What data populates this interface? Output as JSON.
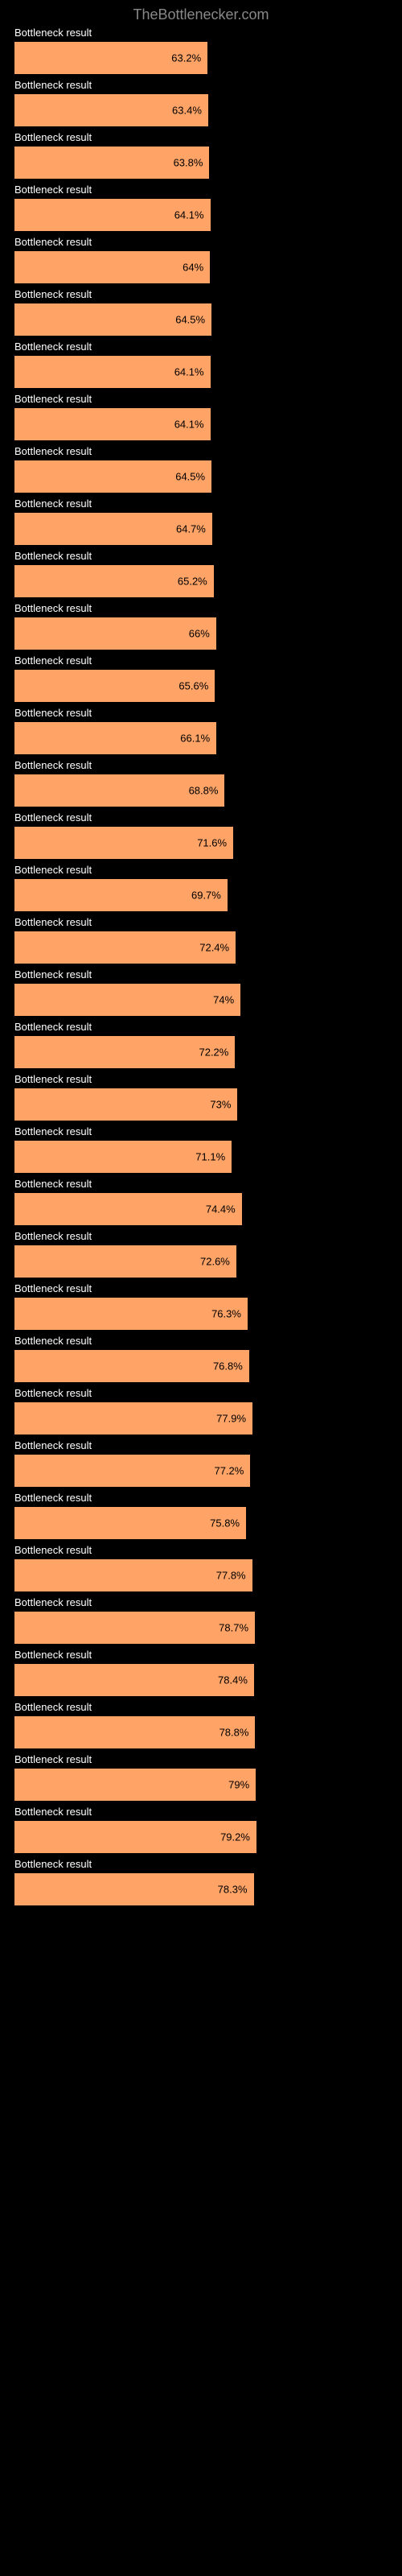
{
  "header": {
    "site": "TheBottlenecker.com"
  },
  "colors": {
    "bar": "#ffa366",
    "background": "#000000",
    "text_label": "#ffffff",
    "text_value": "#000000",
    "header": "#888888"
  },
  "chart_data": {
    "type": "bar",
    "title": "TheBottlenecker.com",
    "xlabel": "",
    "ylabel": "",
    "xlim": [
      0,
      100
    ],
    "categories": [
      "Bottleneck result",
      "Bottleneck result",
      "Bottleneck result",
      "Bottleneck result",
      "Bottleneck result",
      "Bottleneck result",
      "Bottleneck result",
      "Bottleneck result",
      "Bottleneck result",
      "Bottleneck result",
      "Bottleneck result",
      "Bottleneck result",
      "Bottleneck result",
      "Bottleneck result",
      "Bottleneck result",
      "Bottleneck result",
      "Bottleneck result",
      "Bottleneck result",
      "Bottleneck result",
      "Bottleneck result",
      "Bottleneck result",
      "Bottleneck result",
      "Bottleneck result",
      "Bottleneck result",
      "Bottleneck result",
      "Bottleneck result",
      "Bottleneck result",
      "Bottleneck result",
      "Bottleneck result",
      "Bottleneck result",
      "Bottleneck result",
      "Bottleneck result",
      "Bottleneck result",
      "Bottleneck result",
      "Bottleneck result",
      "Bottleneck result"
    ],
    "values": [
      63.2,
      63.4,
      63.8,
      64.1,
      64.0,
      64.5,
      64.1,
      64.1,
      64.5,
      64.7,
      65.2,
      66.0,
      65.6,
      66.1,
      68.8,
      71.6,
      69.7,
      72.4,
      74.0,
      72.2,
      73.0,
      71.1,
      74.4,
      72.6,
      76.3,
      76.8,
      77.9,
      77.2,
      75.8,
      77.8,
      78.7,
      78.4,
      78.8,
      79.0,
      79.2,
      78.3
    ],
    "value_labels": [
      "63.2%",
      "63.4%",
      "63.8%",
      "64.1%",
      "64%",
      "64.5%",
      "64.1%",
      "64.1%",
      "64.5%",
      "64.7%",
      "65.2%",
      "66%",
      "65.6%",
      "66.1%",
      "68.8%",
      "71.6%",
      "69.7%",
      "72.4%",
      "74%",
      "72.2%",
      "73%",
      "71.1%",
      "74.4%",
      "72.6%",
      "76.3%",
      "76.8%",
      "77.9%",
      "77.2%",
      "75.8%",
      "77.8%",
      "78.7%",
      "78.4%",
      "78.8%",
      "79%",
      "79.2%",
      "78.3%"
    ]
  }
}
